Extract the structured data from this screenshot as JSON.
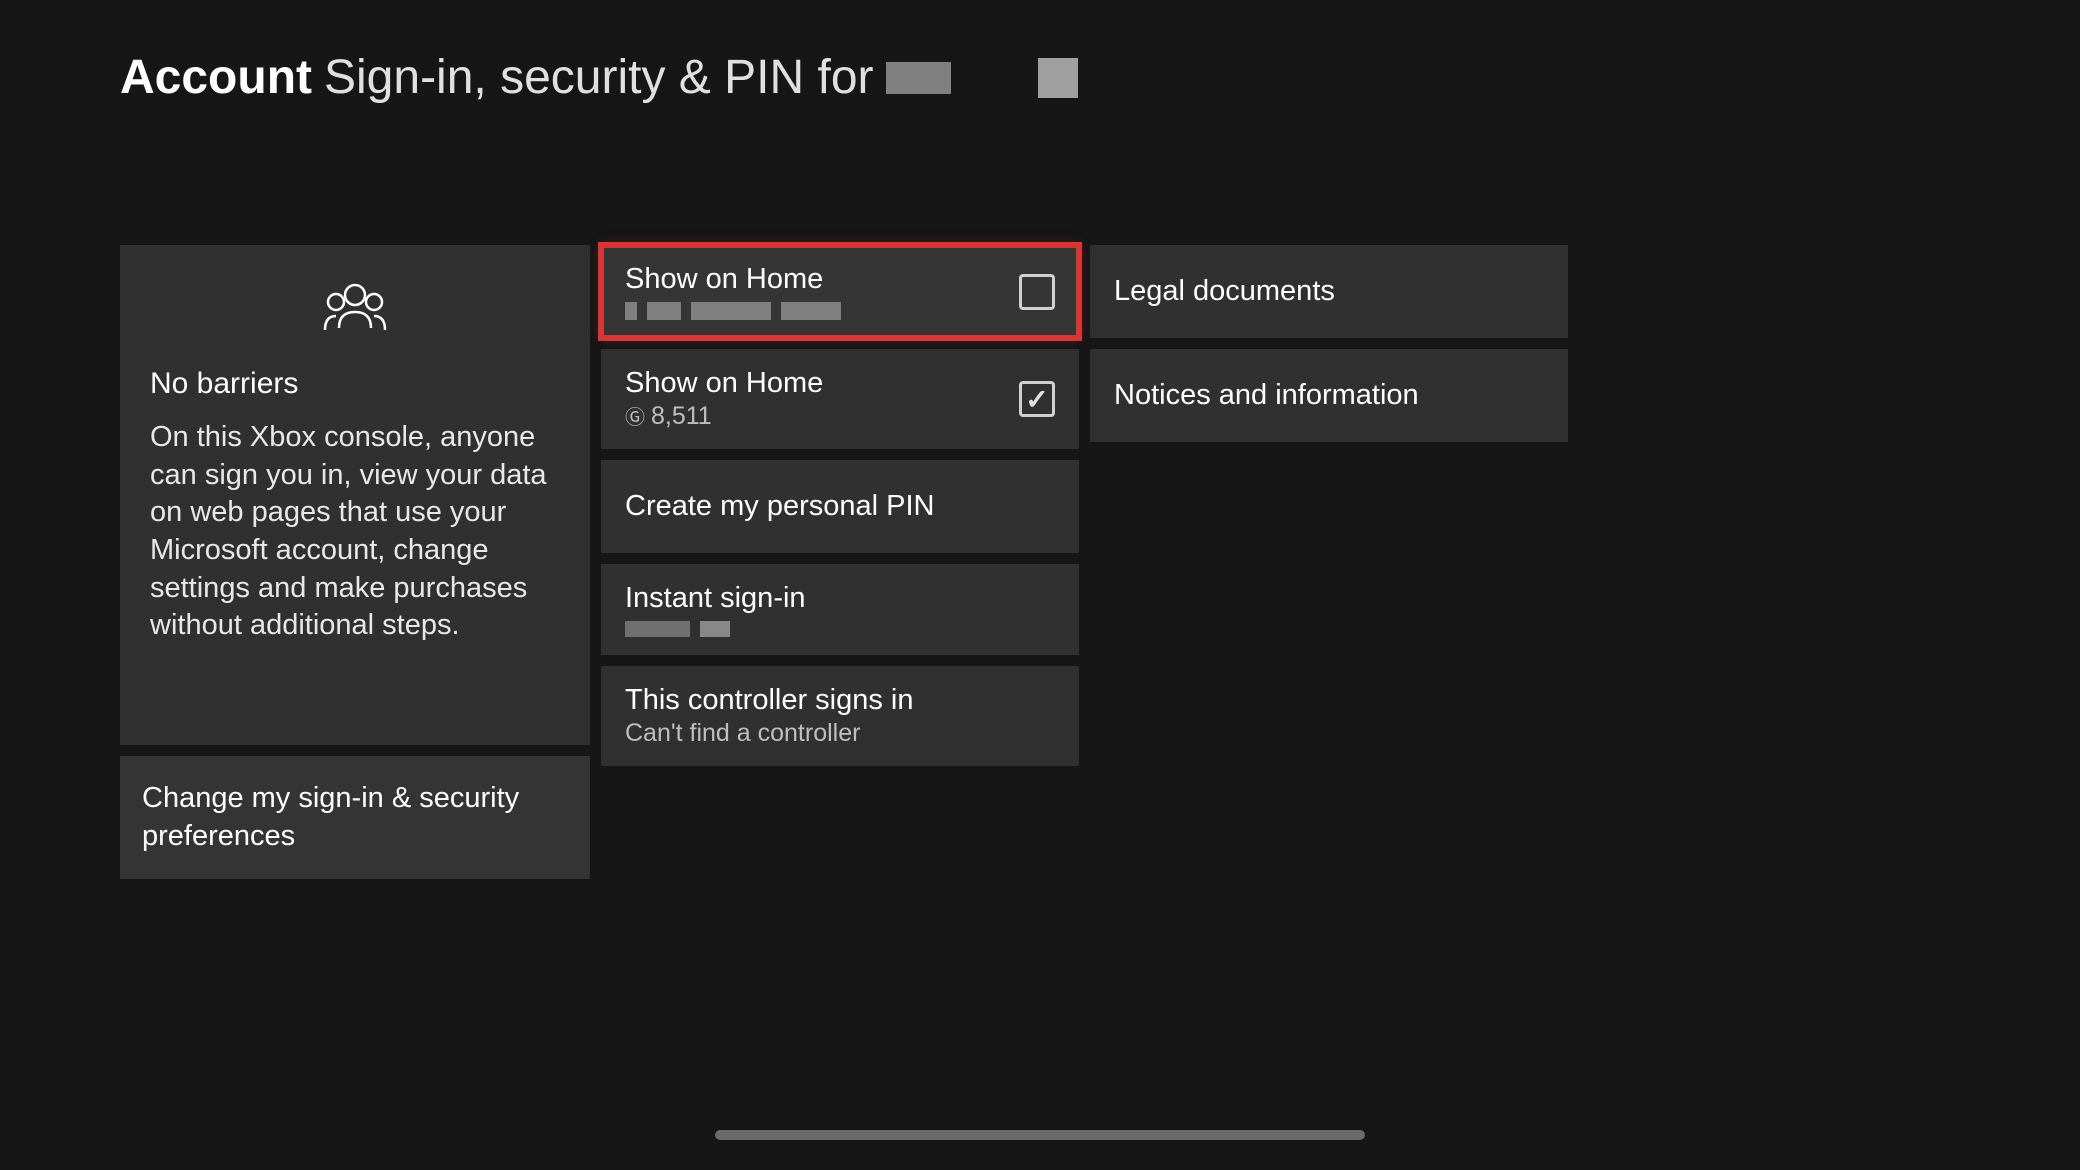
{
  "header": {
    "account_label": "Account",
    "subtitle": "Sign-in, security & PIN for"
  },
  "info_card": {
    "icon": "people-icon",
    "title": "No barriers",
    "body": "On this Xbox console, anyone can sign you in, view your data on web pages that use your Microsoft account, change settings and make purchases without additional steps."
  },
  "left_option": {
    "label": "Change my sign-in & security preferences"
  },
  "mid_options": [
    {
      "title": "Show on Home",
      "sub_redacted": true,
      "checkbox": true,
      "checked": false,
      "highlighted": true
    },
    {
      "title": "Show on Home",
      "gamerscore": "8,511",
      "checkbox": true,
      "checked": true
    },
    {
      "title": "Create my personal PIN"
    },
    {
      "title": "Instant sign-in",
      "sub_redacted_small": true
    },
    {
      "title": "This controller signs in",
      "sub": "Can't find a controller"
    }
  ],
  "right_options": [
    {
      "label": "Legal documents"
    },
    {
      "label": "Notices and information"
    }
  ]
}
